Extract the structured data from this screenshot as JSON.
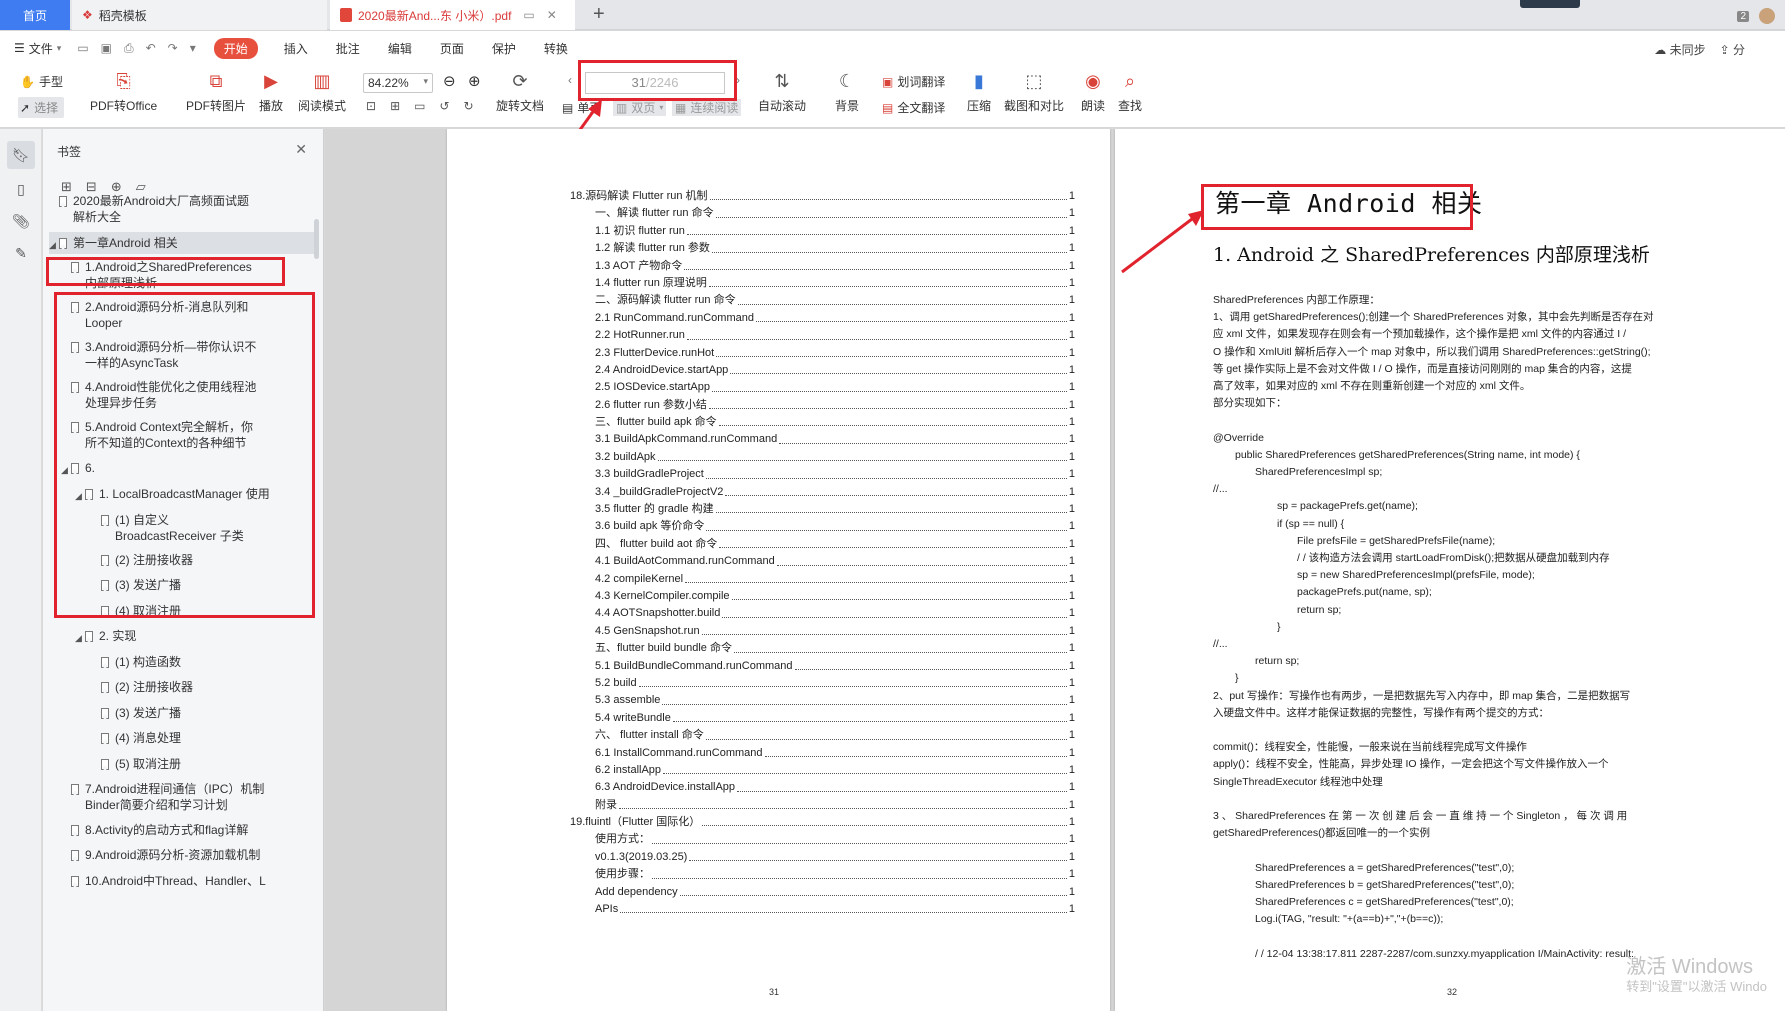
{
  "tabs": {
    "home": "首页",
    "docer": "稻壳模板",
    "pdf": "2020最新And...东 小米）.pdf",
    "window_count": "2"
  },
  "menu": {
    "file": "文件",
    "items": [
      "开始",
      "插入",
      "批注",
      "编辑",
      "页面",
      "保护",
      "转换"
    ],
    "sync": "未同步",
    "share": "分"
  },
  "ribbon": {
    "hand": "手型",
    "select": "选择",
    "pdf_to_office": "PDF转Office",
    "pdf_to_image": "PDF转图片",
    "play": "播放",
    "read_mode": "阅读模式",
    "zoom": "84.22%",
    "rotate": "旋转文档",
    "single_page": "单页",
    "double_page": "双页",
    "continuous": "连续阅读",
    "auto_scroll": "自动滚动",
    "background": "背景",
    "word_translate": "划词翻译",
    "full_translate": "全文翻译",
    "compress": "压缩",
    "screenshot_compare": "截图和对比",
    "read_aloud": "朗读",
    "find": "查找",
    "page_current": "31",
    "page_total": "/2246"
  },
  "bookmarks": {
    "title": "书签",
    "items": [
      "2020最新Android大厂高频面试题解析大全",
      "第一章Android 相关",
      "1.Android之SharedPreferences内部原理浅析",
      "2.Android源码分析-消息队列和Looper",
      "3.Android源码分析—带你认识不一样的AsyncTask",
      "4.Android性能优化之使用线程池处理异步任务",
      "5.Android Context完全解析，你所不知道的Context的各种细节",
      "6.",
      "1. LocalBroadcastManager 使用",
      "(1) 自定义 BroadcastReceiver 子类",
      "(2) 注册接收器",
      "(3) 发送广播",
      "(4) 取消注册",
      "2. 实现",
      "(1) 构造函数",
      "(2) 注册接收器",
      "(3) 发送广播",
      "(4) 消息处理",
      "(5) 取消注册",
      "7.Android进程间通信（IPC）机制Binder简要介绍和学习计划",
      "8.Activity的启动方式和flag详解",
      "9.Android源码分析-资源加载机制",
      "10.Android中Thread、Handler、L"
    ]
  },
  "toc": {
    "rows": [
      "18.源码解读 Flutter run 机制",
      "一、解读 flutter run 命令",
      "1.1 初识 flutter run",
      "1.2 解读 flutter run 参数",
      "1.3 AOT 产物命令",
      "1.4 flutter run 原理说明",
      "二、源码解读 flutter run 命令",
      "2.1 RunCommand.runCommand",
      "2.2 HotRunner.run",
      "2.3 FlutterDevice.runHot",
      "2.4 AndroidDevice.startApp",
      "2.5 IOSDevice.startApp",
      "2.6 flutter run 参数小结",
      "三、flutter build apk 命令",
      "3.1 BuildApkCommand.runCommand",
      "3.2 buildApk",
      "3.3 buildGradleProject",
      "3.4 _buildGradleProjectV2",
      "3.5 flutter 的 gradle 构建",
      "3.6 build apk 等价命令",
      "四、 flutter build aot 命令",
      "4.1 BuildAotCommand.runCommand",
      "4.2 compileKernel",
      "4.3 KernelCompiler.compile",
      "4.4 AOTSnapshotter.build",
      "4.5 GenSnapshot.run",
      "五、flutter build bundle 命令",
      "5.1 BuildBundleCommand.runCommand",
      "5.2 build",
      "5.3 assemble",
      "5.4 writeBundle",
      "六、 flutter install 命令",
      "6.1 InstallCommand.runCommand",
      "6.2 installApp",
      "6.3 AndroidDevice.installApp",
      "附录",
      "19.fluintl（Flutter 国际化）",
      "使用方式：",
      "v0.1.3(2019.03.25)",
      "使用步骤：",
      "Add dependency",
      "APIs"
    ],
    "page_ref": "1",
    "page_number": "31"
  },
  "right_page": {
    "chapter_title": "第一章 Android 相关",
    "section_title": "1. Android 之 SharedPreferences 内部原理浅析",
    "lines": [
      "SharedPreferences 内部工作原理：",
      "1、调用 getSharedPreferences();创建一个 SharedPreferences 对象，其中会先判断是否存在对",
      "应 xml 文件，如果发现存在则会有一个预加载操作，这个操作是把 xml 文件的内容通过 I /",
      "O 操作和 XmlUitl 解析后存入一个 map 对象中，所以我们调用 SharedPreferences::getString();",
      "等 get 操作实际上是不会对文件做 I / O 操作，而是直接访问刚刚的 map 集合的内容，这提",
      "高了效率，如果对应的 xml 不存在则重新创建一个对应的 xml 文件。",
      "部分实现如下：",
      "",
      "@Override",
      "public SharedPreferences getSharedPreferences(String name, int mode) {",
      "SharedPreferencesImpl sp;",
      "//...",
      "sp = packagePrefs.get(name);",
      "if (sp == null) {",
      "File prefsFile = getSharedPrefsFile(name);",
      "/ / 该构造方法会调用 startLoadFromDisk();把数据从硬盘加载到内存",
      "sp = new SharedPreferencesImpl(prefsFile, mode);",
      "packagePrefs.put(name, sp);",
      "return sp;",
      "}",
      "//...",
      "return sp;",
      "}",
      "2、put 写操作：写操作也有两步，一是把数据先写入内存中，即 map 集合，二是把数据写",
      "入硬盘文件中。这样才能保证数据的完整性，写操作有两个提交的方式：",
      "",
      "commit()：线程安全，性能慢，一般来说在当前线程完成写文件操作",
      "apply()：线程不安全，性能高，异步处理 IO 操作，一定会把这个写文件操作放入一个",
      "SingleThreadExecutor 线程池中处理",
      "",
      "3 、 SharedPreferences 在 第 一 次 创 建 后 会 一 直 维 持 一 个 Singleton ， 每 次 调 用",
      "getSharedPreferences()都返回唯一的一个实例",
      "",
      "SharedPreferences a = getSharedPreferences(\"test\",0);",
      "SharedPreferences b = getSharedPreferences(\"test\",0);",
      "SharedPreferences c = getSharedPreferences(\"test\",0);",
      "Log.i(TAG, \"result: \"+(a==b)+\",\"+(b==c));",
      "",
      "/ / 12-04 13:38:17.811 2287-2287/com.sunzxy.myapplication I/MainActivity: result:"
    ],
    "page_number": "32"
  },
  "watermark": {
    "line1": "激活 Windows",
    "line2": "转到\"设置\"以激活 Windo"
  },
  "colors": {
    "accent": "#3f7cf1",
    "active_menu": "#e8503e",
    "highlight": "#e0232d"
  }
}
